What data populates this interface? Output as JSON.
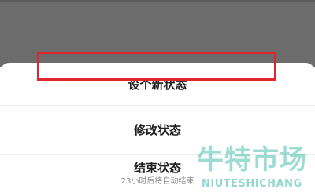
{
  "sheet": {
    "items": [
      {
        "label": "设个新状态"
      },
      {
        "label": "修改状态"
      },
      {
        "label": "结束状态",
        "sublabel": "23小时后将自动结束"
      }
    ]
  },
  "highlight": {
    "color": "#e0262e",
    "target": "修改状态"
  },
  "watermark": {
    "chinese": "牛特市场",
    "english": "NIUTESHICHANG",
    "color": "#26b29c"
  }
}
